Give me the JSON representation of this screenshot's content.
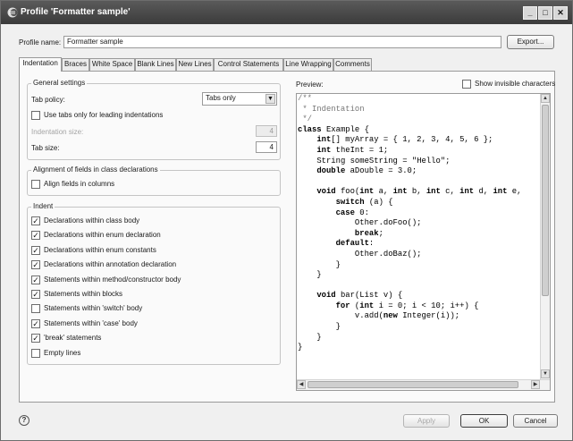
{
  "window": {
    "title": "Profile 'Formatter sample'",
    "controls": {
      "minimize": "_",
      "maximize": "□",
      "close": "✕"
    }
  },
  "profile": {
    "name_label": "Profile name:",
    "name_value": "Formatter sample",
    "export_label": "Export..."
  },
  "tabs": [
    {
      "label": "Indentation",
      "active": true
    },
    {
      "label": "Braces"
    },
    {
      "label": "White Space"
    },
    {
      "label": "Blank Lines"
    },
    {
      "label": "New Lines"
    },
    {
      "label": "Control Statements"
    },
    {
      "label": "Line Wrapping"
    },
    {
      "label": "Comments"
    }
  ],
  "general": {
    "title": "General settings",
    "tab_policy_label": "Tab policy:",
    "tab_policy_value": "Tabs only",
    "leading_label": "Use tabs only for leading indentations",
    "leading_checked": false,
    "indent_size_label": "Indentation size:",
    "indent_size_value": "4",
    "tab_size_label": "Tab size:",
    "tab_size_value": "4"
  },
  "alignment": {
    "title": "Alignment of fields in class declarations",
    "align_label": "Align fields in columns",
    "align_checked": false
  },
  "indent": {
    "title": "Indent",
    "items": [
      {
        "label": "Declarations within class body",
        "checked": true
      },
      {
        "label": "Declarations within enum declaration",
        "checked": true
      },
      {
        "label": "Declarations within enum constants",
        "checked": true
      },
      {
        "label": "Declarations within annotation declaration",
        "checked": true
      },
      {
        "label": "Statements within method/constructor body",
        "checked": true
      },
      {
        "label": "Statements within blocks",
        "checked": true
      },
      {
        "label": "Statements within 'switch' body",
        "checked": false
      },
      {
        "label": "Statements within 'case' body",
        "checked": true
      },
      {
        "label": "'break' statements",
        "checked": true
      },
      {
        "label": "Empty lines",
        "checked": false
      }
    ]
  },
  "preview": {
    "label": "Preview:",
    "show_invisible_label": "Show invisible characters",
    "show_invisible_checked": false,
    "code": [
      "/**",
      " * Indentation",
      " */",
      "class Example {",
      "    int[] myArray = { 1, 2, 3, 4, 5, 6 };",
      "    int theInt = 1;",
      "    String someString = \"Hello\";",
      "    double aDouble = 3.0;",
      "",
      "    void foo(int a, int b, int c, int d, int e,",
      "        switch (a) {",
      "        case 0:",
      "            Other.doFoo();",
      "            break;",
      "        default:",
      "            Other.doBaz();",
      "        }",
      "    }",
      "",
      "    void bar(List v) {",
      "        for (int i = 0; i < 10; i++) {",
      "            v.add(new Integer(i));",
      "        }",
      "    }",
      "}"
    ]
  },
  "buttons": {
    "apply": "Apply",
    "ok": "OK",
    "cancel": "Cancel",
    "help": "?"
  },
  "colors": {
    "titlebar": "#474747",
    "panel": "#fafafa",
    "dialog": "#f0f0f0"
  }
}
